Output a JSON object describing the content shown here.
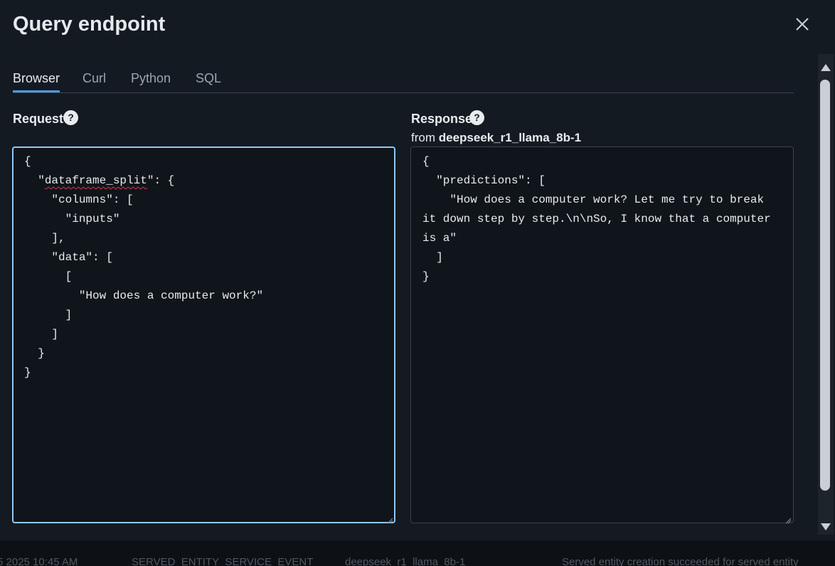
{
  "modal": {
    "title": "Query endpoint",
    "tabs": [
      {
        "label": "Browser",
        "active": true
      },
      {
        "label": "Curl",
        "active": false
      },
      {
        "label": "Python",
        "active": false
      },
      {
        "label": "SQL",
        "active": false
      }
    ]
  },
  "request": {
    "label": "Request",
    "help": "?",
    "lines": [
      "{",
      "  \"",
      "dataframe_split",
      "\": {",
      "    \"columns\": [",
      "      \"inputs\"",
      "    ],",
      "    \"data\": [",
      "      [",
      "        \"How does a computer work?\"",
      "      ]",
      "    ]",
      "  }",
      "}"
    ]
  },
  "response": {
    "label": "Response",
    "help": "?",
    "from_prefix": "from",
    "endpoint_name": "deepseek_r1_llama_8b-1",
    "text": "{\n  \"predictions\": [\n    \"How does a computer work? Let me try to break it down step by step.\\n\\nSo, I know that a computer is a\"\n  ]\n}"
  },
  "background_row": [
    "5 2025 10:45 AM",
    "SERVED_ENTITY_SERVICE_EVENT",
    "deepseek_r1_llama_8b-1",
    "Served entity creation succeeded for served entity"
  ],
  "icons": {
    "close": "close-icon",
    "help": "question-icon",
    "resize": "resize-grip-icon"
  },
  "colors": {
    "accent": "#4a9be0",
    "focus_border": "#8ec9f5",
    "background": "#141a21",
    "spellcheck": "#e0383e"
  }
}
